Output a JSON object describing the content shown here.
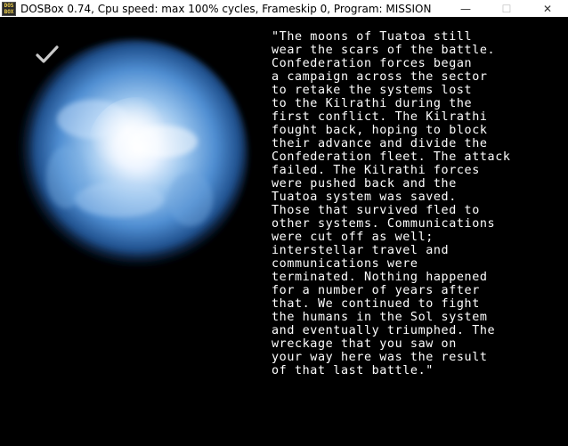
{
  "window": {
    "title": "DOSBox 0.74, Cpu speed: max 100% cycles, Frameskip  0, Program:  MISSION",
    "app_icon_lines": [
      "DOS",
      "BOX"
    ],
    "controls": {
      "minimize": "—",
      "maximize": "☐",
      "close": "✕"
    }
  },
  "scene": {
    "planet_icon": "blue-planet-nebula",
    "check_icon": "checkmark-icon"
  },
  "story": {
    "lines": [
      "\"The moons of Tuatoa still",
      "wear the scars of the battle.",
      "Confederation forces began",
      "a campaign across the sector",
      "to retake the systems lost",
      "to the Kilrathi during the",
      "first conflict. The Kilrathi",
      "fought back, hoping to block",
      "their advance and divide the",
      "Confederation fleet. The attack",
      "failed. The Kilrathi forces",
      "were pushed back and the",
      "Tuatoa system was saved.",
      "Those that survived fled to",
      "other systems. Communications",
      "were cut off as well;",
      "interstellar travel and",
      "communications were",
      "terminated. Nothing happened",
      "for a number of years after",
      "that. We continued to fight",
      "the humans in the Sol system",
      "and eventually triumphed. The",
      "wreckage that you saw on",
      "your way here was the result",
      "of that last battle.\""
    ]
  }
}
